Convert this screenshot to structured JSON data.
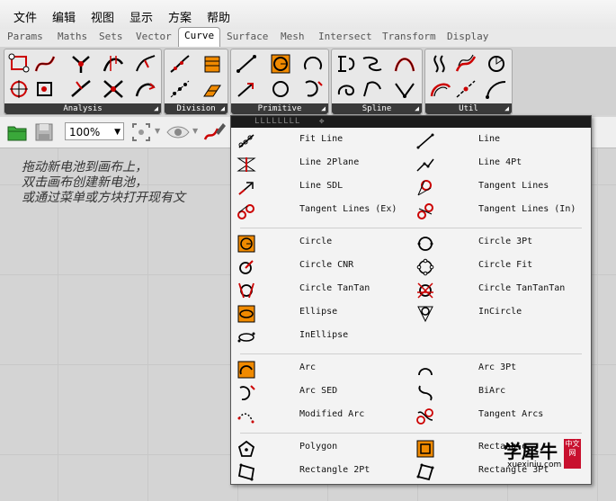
{
  "menubar": {
    "items": [
      "文件",
      "编辑",
      "视图",
      "显示",
      "方案",
      "帮助"
    ]
  },
  "tabs": [
    {
      "label": "Params",
      "active": false
    },
    {
      "label": "Maths",
      "active": false
    },
    {
      "label": "Sets",
      "active": false
    },
    {
      "label": "Vector",
      "active": false
    },
    {
      "label": "Curve",
      "active": true
    },
    {
      "label": "Surface",
      "active": false
    },
    {
      "label": "Mesh",
      "active": false
    },
    {
      "label": "Intersect",
      "active": false
    },
    {
      "label": "Transform",
      "active": false
    },
    {
      "label": "Display",
      "active": false
    }
  ],
  "ribbon": {
    "groups": [
      "Analysis",
      "Division",
      "Primitive",
      "Spline",
      "Util"
    ]
  },
  "toolbar": {
    "zoom": "100%"
  },
  "canvas": {
    "hint_lines": [
      "拖动新电池到画布上，",
      "双击画布创建新电池，",
      "或通过菜单或方块打开现有文"
    ]
  },
  "popup": {
    "header": "LLLLLLLL",
    "items": [
      {
        "label": "Fit Line",
        "icon": "fit-line-icon"
      },
      {
        "label": "Line",
        "icon": "line-icon"
      },
      {
        "label": "Line 2Plane",
        "icon": "line-2plane-icon"
      },
      {
        "label": "Line 4Pt",
        "icon": "line-4pt-icon"
      },
      {
        "label": "Line SDL",
        "icon": "line-sdl-icon"
      },
      {
        "label": "Tangent Lines",
        "icon": "tangent-lines-icon"
      },
      {
        "label": "Tangent Lines (Ex)",
        "icon": "tangent-lines-ex-icon"
      },
      {
        "label": "Tangent Lines (In)",
        "icon": "tangent-lines-in-icon"
      },
      {
        "label": "Circle",
        "icon": "circle-icon"
      },
      {
        "label": "Circle 3Pt",
        "icon": "circle-3pt-icon"
      },
      {
        "label": "Circle CNR",
        "icon": "circle-cnr-icon"
      },
      {
        "label": "Circle Fit",
        "icon": "circle-fit-icon"
      },
      {
        "label": "Circle TanTan",
        "icon": "circle-tantan-icon"
      },
      {
        "label": "Circle TanTanTan",
        "icon": "circle-tantantan-icon"
      },
      {
        "label": "Ellipse",
        "icon": "ellipse-icon"
      },
      {
        "label": "InCircle",
        "icon": "incircle-icon"
      },
      {
        "label": "InEllipse",
        "icon": "inellipse-icon"
      },
      {
        "label": "Arc",
        "icon": "arc-icon"
      },
      {
        "label": "Arc 3Pt",
        "icon": "arc-3pt-icon"
      },
      {
        "label": "Arc SED",
        "icon": "arc-sed-icon"
      },
      {
        "label": "BiArc",
        "icon": "biarc-icon"
      },
      {
        "label": "Modified Arc",
        "icon": "modified-arc-icon"
      },
      {
        "label": "Tangent Arcs",
        "icon": "tangent-arcs-icon"
      },
      {
        "label": "Polygon",
        "icon": "polygon-icon"
      },
      {
        "label": "Rectangle",
        "icon": "rectangle-icon"
      },
      {
        "label": "Rectangle 2Pt",
        "icon": "rectangle-2pt-icon"
      },
      {
        "label": "Rectangle 3Pt",
        "icon": "rectangle-3pt-icon"
      }
    ]
  },
  "watermark": {
    "text": "学犀牛",
    "badge": "中文网",
    "site": "xuexiniu.com"
  },
  "colors": {
    "accent_orange": "#f08a00",
    "curve_red": "#c00000",
    "header_dark": "#1c1c1c"
  }
}
